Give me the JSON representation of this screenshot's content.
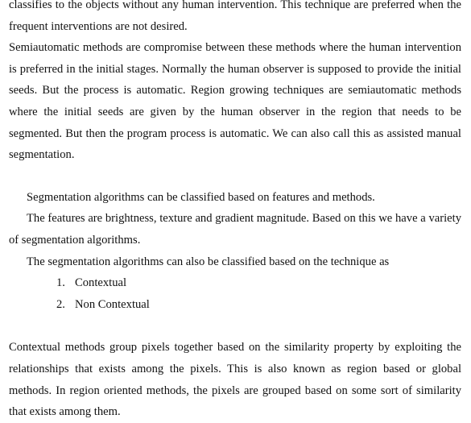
{
  "document": {
    "paragraphs_top": [
      "classifies to the objects without any human intervention. This technique are preferred when the frequent interventions are not desired.",
      "Semiautomatic methods are compromise between these methods where the human intervention is preferred in the initial stages. Normally the human observer is supposed to provide the initial seeds. But the process is automatic. Region growing techniques are semiautomatic methods where the initial seeds are given by the human observer in the region that needs to be segmented. But then the program process is automatic. We can also call this as assisted manual segmentation."
    ],
    "indented": [
      "Segmentation algorithms can be classified based on features and methods.",
      "The features are brightness, texture and gradient magnitude. Based on this we have a variety of segmentation algorithms.",
      "The segmentation algorithms can also be classified based on the technique as"
    ],
    "list": [
      {
        "num": "1.",
        "text": "Contextual"
      },
      {
        "num": "2.",
        "text": "Non Contextual"
      }
    ],
    "paragraph_bottom": "Contextual methods group pixels together based on the similarity property by exploiting the relationships that exists among the pixels. This is also known as region based or global methods. In region oriented methods, the pixels are grouped based on some sort of similarity that exists among them."
  }
}
